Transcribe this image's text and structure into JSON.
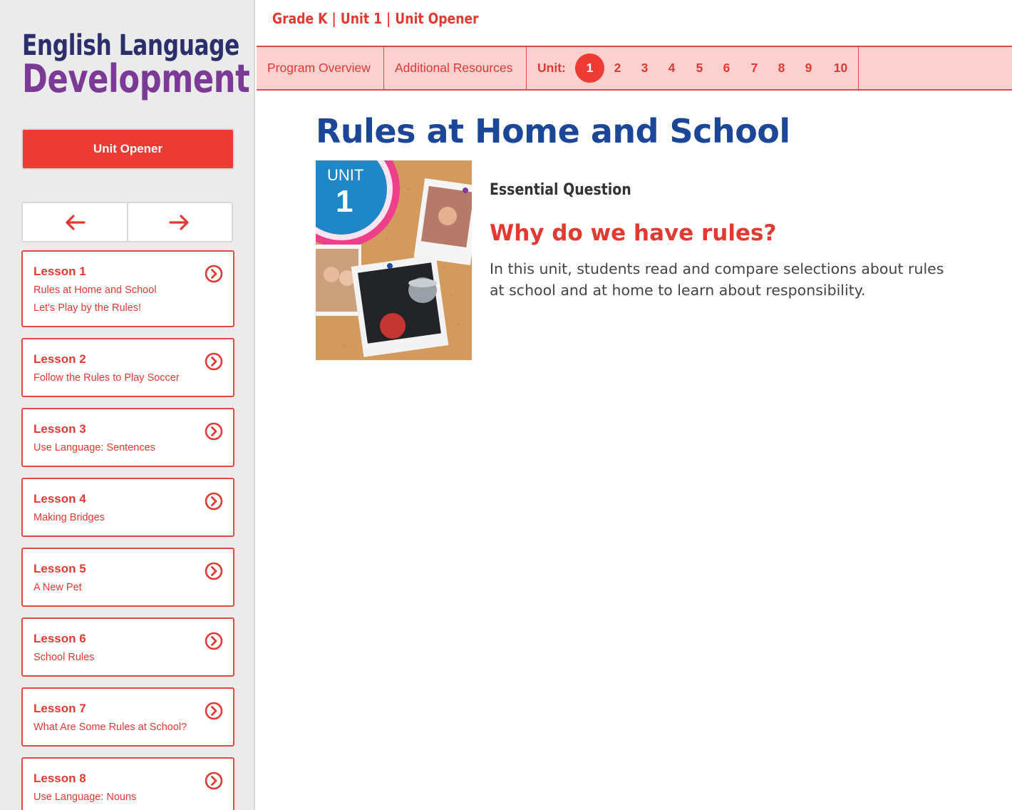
{
  "sidebar": {
    "logo_line1": "English Language",
    "logo_line2": "Development",
    "unit_opener_label": "Unit Opener",
    "prev_icon": "arrow-left-icon",
    "next_icon": "arrow-right-icon",
    "lessons": [
      {
        "title": "Lesson 1",
        "subtitle": "Rules at Home and School",
        "subtitle2": "Let's Play by the Rules!"
      },
      {
        "title": "Lesson 2",
        "subtitle": "Follow the Rules to Play Soccer"
      },
      {
        "title": "Lesson 3",
        "subtitle": "Use Language: Sentences"
      },
      {
        "title": "Lesson 4",
        "subtitle": "Making Bridges"
      },
      {
        "title": "Lesson 5",
        "subtitle": "A New Pet"
      },
      {
        "title": "Lesson 6",
        "subtitle": "School Rules"
      },
      {
        "title": "Lesson 7",
        "subtitle": "What Are Some Rules at School?"
      },
      {
        "title": "Lesson 8",
        "subtitle": "Use Language: Nouns"
      }
    ]
  },
  "breadcrumb": "Grade K | Unit 1 | Unit Opener",
  "nav": {
    "program_overview": "Program Overview",
    "additional_resources": "Additional Resources",
    "unit_label": "Unit:",
    "units": [
      "1",
      "2",
      "3",
      "4",
      "5",
      "6",
      "7",
      "8",
      "9",
      "10"
    ],
    "active_unit": "1"
  },
  "main": {
    "title": "Rules at Home and School",
    "cover_unit_label": "UNIT",
    "cover_unit_number": "1",
    "eq_label": "Essential Question",
    "eq_question": "Why do we have rules?",
    "eq_description": "In this unit, students read and compare selections about rules at school and at home to learn about responsibility."
  },
  "colors": {
    "accent_red": "#ee3b33",
    "title_blue": "#1c4698",
    "nav_bg": "#fbd0cf",
    "logo_navy": "#2b2f6b",
    "logo_purple": "#7a3a96"
  }
}
